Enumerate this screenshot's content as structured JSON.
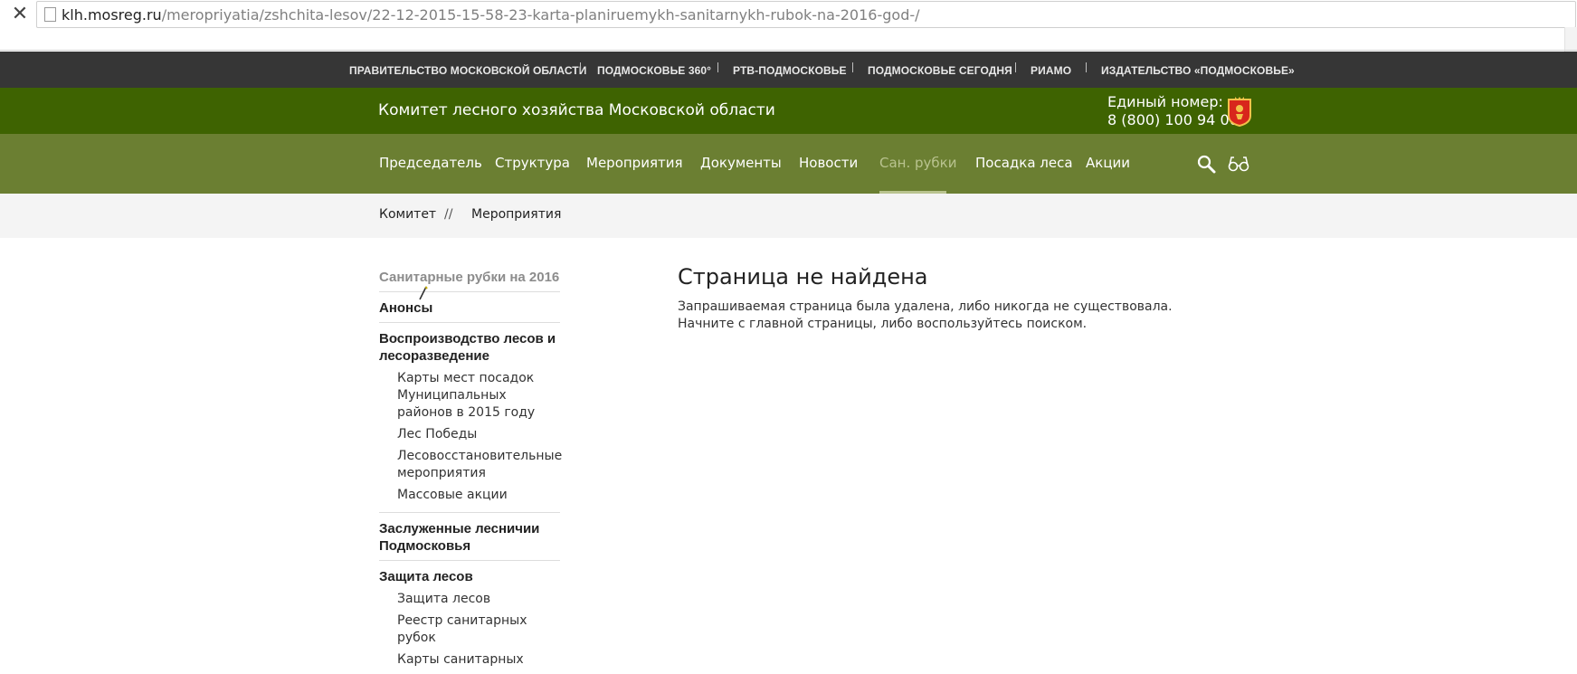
{
  "browser": {
    "url_host": "klh.mosreg.ru",
    "url_path": "/meropriyatia/zshchita-lesov/22-12-2015-15-58-23-karta-planiruemykh-sanitarnykh-rubok-na-2016-god-/"
  },
  "top_links": [
    {
      "label": "ПРАВИТЕЛЬСТВО МОСКОВСКОЙ ОБЛАСТИ"
    },
    {
      "label": "ПОДМОСКОВЬЕ 360°"
    },
    {
      "label": "РТВ-ПОДМОСКОВЬЕ"
    },
    {
      "label": "ПОДМОСКОВЬЕ СЕГОДНЯ"
    },
    {
      "label": "РИАМО"
    },
    {
      "label": "ИЗДАТЕЛЬСТВО «ПОДМОСКОВЬЕ»"
    }
  ],
  "header": {
    "title": "Комитет лесного хозяйства Московской области",
    "phone_label": "Единый номер:",
    "phone_number": "8 (800) 100 94 00"
  },
  "nav": [
    {
      "label": "Председатель"
    },
    {
      "label": "Структура"
    },
    {
      "label": "Мероприятия"
    },
    {
      "label": "Документы"
    },
    {
      "label": "Новости"
    },
    {
      "label": "Сан. рубки",
      "active": true
    },
    {
      "label": "Посадка леса"
    },
    {
      "label": "Акции"
    }
  ],
  "breadcrumb": {
    "items": [
      "Комитет",
      "Мероприятия"
    ],
    "separator": "//"
  },
  "sidebar": {
    "current": "Санитарные рубки на 2016",
    "sections": [
      {
        "title": "Анонсы",
        "items": []
      },
      {
        "title": "Воспроизводство лесов и лесоразведение",
        "items": [
          "Карты мест посадок Муниципальных районов в 2015 году",
          "Лес Победы",
          "Лесовосстановительные мероприятия",
          "Массовые акции"
        ]
      },
      {
        "title": "Заслуженные лесничии Подмосковья",
        "items": []
      },
      {
        "title": "Защита лесов",
        "items": [
          "Защита лесов",
          "Реестр санитарных рубок",
          "Карты санитарных"
        ]
      }
    ]
  },
  "main": {
    "title": "Страница не найдена",
    "line1": "Запрашиваемая страница была удалена, либо никогда не существовала.",
    "line2": "Начните с главной страницы, либо воспользуйтесь поиском."
  },
  "colors": {
    "top_strip": "#363636",
    "header": "#3e6301",
    "nav": "#6b7f32",
    "nav_active": "#b9c38f"
  }
}
